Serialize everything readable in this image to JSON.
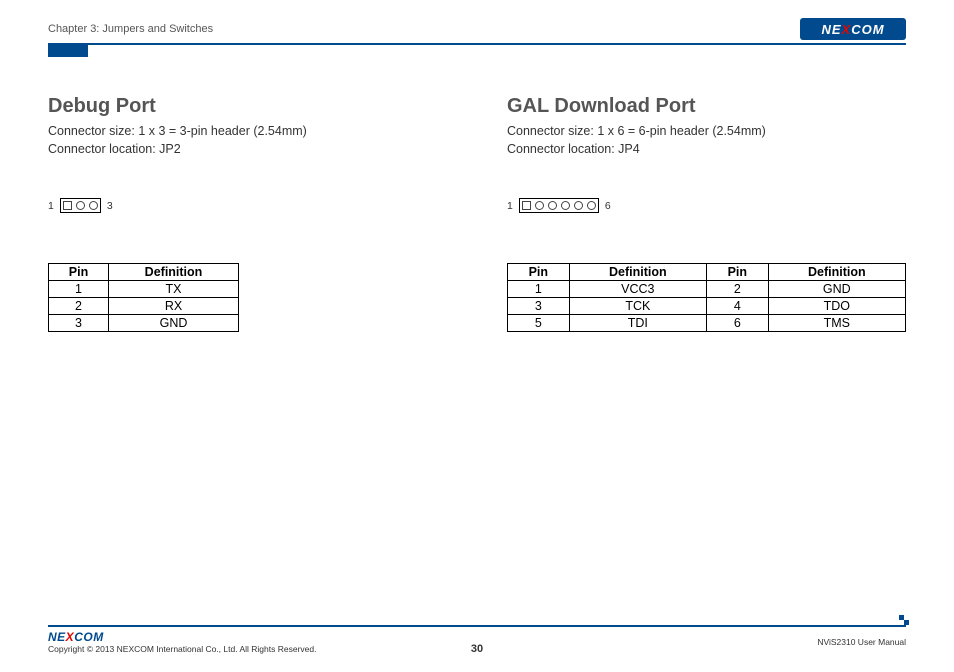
{
  "header": {
    "chapter": "Chapter 3: Jumpers and Switches",
    "brand_pre": "NE",
    "brand_x": "X",
    "brand_post": "COM"
  },
  "left": {
    "title": "Debug Port",
    "size": "Connector size: 1 x 3 = 3-pin header (2.54mm)",
    "loc": "Connector location: JP2",
    "diag_left": "1",
    "diag_right": "3",
    "th_pin": "Pin",
    "th_def": "Definition",
    "rows": [
      {
        "pin": "1",
        "def": "TX"
      },
      {
        "pin": "2",
        "def": "RX"
      },
      {
        "pin": "3",
        "def": "GND"
      }
    ]
  },
  "right": {
    "title": "GAL Download Port",
    "size": "Connector size: 1 x 6 = 6-pin header (2.54mm)",
    "loc": "Connector location: JP4",
    "diag_left": "1",
    "diag_right": "6",
    "th_pin": "Pin",
    "th_def": "Definition",
    "rows": [
      {
        "p1": "1",
        "d1": "VCC3",
        "p2": "2",
        "d2": "GND"
      },
      {
        "p1": "3",
        "d1": "TCK",
        "p2": "4",
        "d2": "TDO"
      },
      {
        "p1": "5",
        "d1": "TDI",
        "p2": "6",
        "d2": "TMS"
      }
    ]
  },
  "footer": {
    "brand_pre": "NE",
    "brand_x": "X",
    "brand_post": "COM",
    "copyright": "Copyright © 2013 NEXCOM International Co., Ltd. All Rights Reserved.",
    "page": "30",
    "manual": "NViS2310 User Manual"
  }
}
